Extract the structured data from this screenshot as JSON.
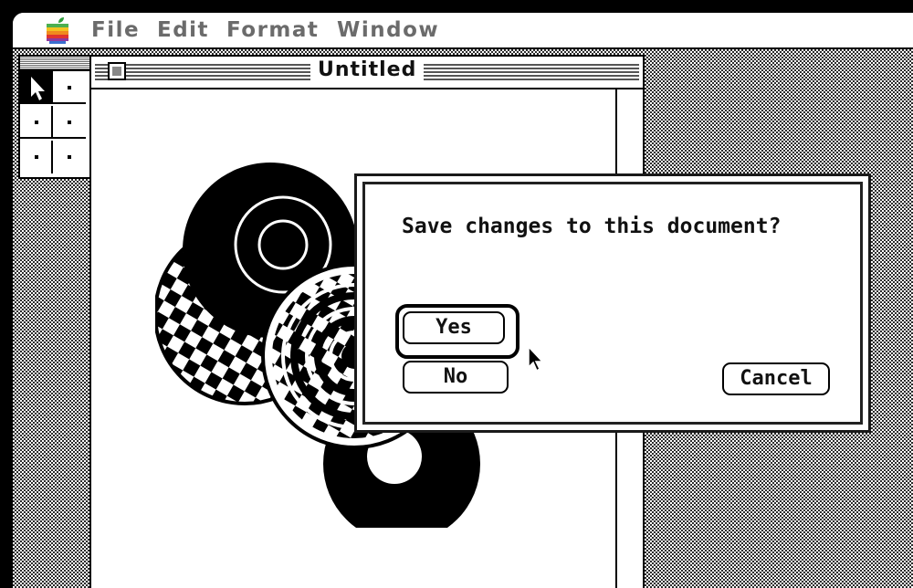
{
  "menubar": {
    "items": [
      "File",
      "Edit",
      "Format",
      "Window"
    ]
  },
  "document": {
    "title": "Untitled"
  },
  "dialog": {
    "message": "Save changes to this document?",
    "yes_label": "Yes",
    "no_label": "No",
    "cancel_label": "Cancel",
    "default_button": "Yes"
  }
}
